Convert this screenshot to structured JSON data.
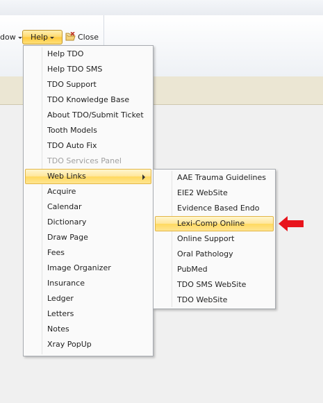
{
  "toolbar": {
    "window_label": "dow",
    "help_label": "Help",
    "close_label": "Close"
  },
  "help_menu": {
    "items": [
      {
        "label": "Help TDO",
        "enabled": true
      },
      {
        "label": "Help TDO SMS",
        "enabled": true
      },
      {
        "label": "TDO Support",
        "enabled": true
      },
      {
        "label": "TDO Knowledge Base",
        "enabled": true
      },
      {
        "label": "About TDO/Submit Ticket",
        "enabled": true
      },
      {
        "label": "Tooth Models",
        "enabled": true
      },
      {
        "label": "TDO Auto Fix",
        "enabled": true
      },
      {
        "label": "TDO Services Panel",
        "enabled": false
      },
      {
        "label": "Web Links",
        "enabled": true,
        "highlighted": true,
        "has_submenu": true
      },
      {
        "label": "Acquire",
        "enabled": true
      },
      {
        "label": "Calendar",
        "enabled": true
      },
      {
        "label": "Dictionary",
        "enabled": true
      },
      {
        "label": "Draw Page",
        "enabled": true
      },
      {
        "label": "Fees",
        "enabled": true
      },
      {
        "label": "Image Organizer",
        "enabled": true
      },
      {
        "label": "Insurance",
        "enabled": true
      },
      {
        "label": "Ledger",
        "enabled": true
      },
      {
        "label": "Letters",
        "enabled": true
      },
      {
        "label": "Notes",
        "enabled": true
      },
      {
        "label": "Xray PopUp",
        "enabled": true
      }
    ]
  },
  "web_links_menu": {
    "items": [
      {
        "label": "AAE Trauma Guidelines"
      },
      {
        "label": "EIE2 WebSite"
      },
      {
        "label": "Evidence Based Endo"
      },
      {
        "label": "Lexi-Comp Online",
        "highlighted": true
      },
      {
        "label": "Online Support"
      },
      {
        "label": "Oral Pathology"
      },
      {
        "label": "PubMed"
      },
      {
        "label": "TDO SMS WebSite"
      },
      {
        "label": "TDO WebSite"
      }
    ]
  },
  "colors": {
    "highlight": "#ffe69a",
    "highlight_border": "#e3b646",
    "annotation_arrow": "#e8141c",
    "tab_band": "#ebe6d3"
  },
  "icons": {
    "close": "close-folder-icon",
    "annotation": "red-arrow-icon",
    "submenu": "submenu-arrow-icon"
  }
}
